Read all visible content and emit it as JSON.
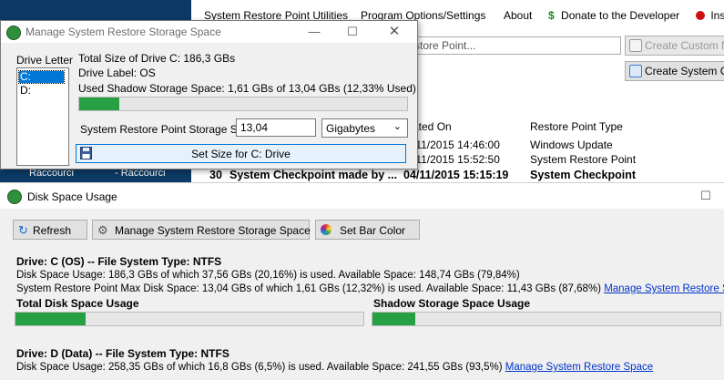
{
  "desktop": {
    "shortcut_labels": [
      "Raccourci",
      "- Raccourci"
    ]
  },
  "main_app": {
    "menu": [
      "System Restore Point Utilities",
      "Program Options/Settings",
      "About",
      "Donate to the Developer",
      "Ins"
    ],
    "search_placeholder": "store Point...",
    "buttons": {
      "create_custom": "Create Custom Na",
      "create_system": "Create System Che"
    },
    "columns": {
      "created": "ated On",
      "type": "Restore Point Type"
    },
    "rows": [
      {
        "id": "",
        "name": "",
        "date": "/11/2015 14:46:00",
        "type": "Windows Update"
      },
      {
        "id": "",
        "name": "",
        "date": "/11/2015 15:52:50",
        "type": "System Restore Point"
      },
      {
        "id": "30",
        "name": "System Checkpoint made by ...",
        "date": "04/11/2015 15:15:19",
        "type": "System Checkpoint"
      }
    ]
  },
  "manage_dialog": {
    "title": "Manage System Restore Storage Space",
    "drive_letter_label": "Drive Letter",
    "drives": [
      "C:",
      "D:"
    ],
    "selected_drive": "C:",
    "total_size": "Total Size of Drive C: 186,3 GBs",
    "drive_label": "Drive Label: OS",
    "used_shadow": "Used Shadow Storage Space: 1,61 GBs of 13,04 GBs (12,33% Used)",
    "used_fraction": 0.1233,
    "storage_size_label": "System Restore Point Storage Size:",
    "storage_size_value": "13,04",
    "unit": "Gigabytes",
    "set_button": "Set Size for C: Drive"
  },
  "disk_window": {
    "title": "Disk Space Usage",
    "toolbar": {
      "refresh": "Refresh",
      "manage": "Manage System Restore Storage Space",
      "bar_color": "Set Bar Color"
    },
    "drives": [
      {
        "heading": "Drive: C (OS) -- File System Type: NTFS",
        "usage": "Disk Space Usage: 186,3 GBs of which 37,56 GBs (20,16%) is used.  Available Space: 148,74 GBs (79,84%)",
        "restore": "System Restore Point Max Disk Space: 13,04 GBs of which 1,61 GBs (12,32%) is used.  Available Space: 11,43 GBs (87,68%)",
        "manage_link": "Manage System Restore Space",
        "total_heading": "Total Disk Space Usage",
        "shadow_heading": "Shadow Storage Space Usage",
        "total_fraction": 0.2016,
        "shadow_fraction": 0.1232
      },
      {
        "heading": "Drive: D (Data) -- File System Type: NTFS",
        "usage": "Disk Space Usage: 258,35 GBs of which 16,8 GBs (6,5%) is used.  Available Space: 241,55 GBs (93,5%)",
        "manage_link": "Manage System Restore Space"
      }
    ]
  },
  "colors": {
    "accent": "#0078d7",
    "bar_fill": "#26a042",
    "link": "#0033cc",
    "desktop": "#0b3a66"
  }
}
